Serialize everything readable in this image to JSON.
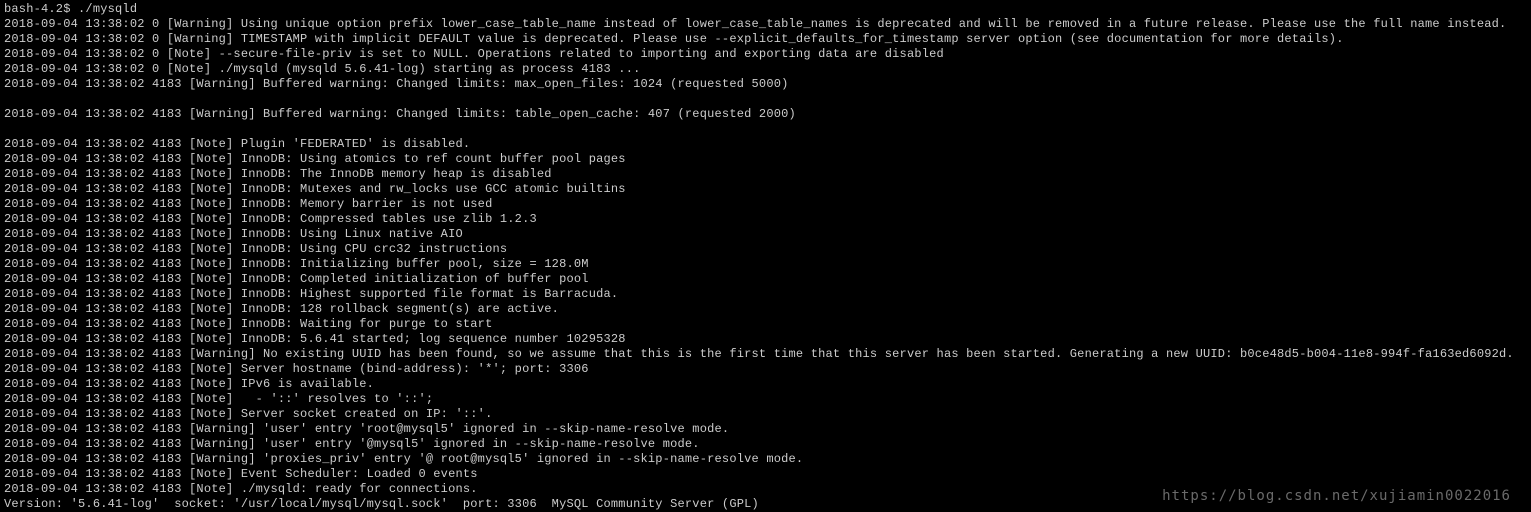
{
  "prompt": "bash-4.2$ ./mysqld",
  "lines": [
    "2018-09-04 13:38:02 0 [Warning] Using unique option prefix lower_case_table_name instead of lower_case_table_names is deprecated and will be removed in a future release. Please use the full name instead.",
    "2018-09-04 13:38:02 0 [Warning] TIMESTAMP with implicit DEFAULT value is deprecated. Please use --explicit_defaults_for_timestamp server option (see documentation for more details).",
    "2018-09-04 13:38:02 0 [Note] --secure-file-priv is set to NULL. Operations related to importing and exporting data are disabled",
    "2018-09-04 13:38:02 0 [Note] ./mysqld (mysqld 5.6.41-log) starting as process 4183 ...",
    "2018-09-04 13:38:02 4183 [Warning] Buffered warning: Changed limits: max_open_files: 1024 (requested 5000)",
    "",
    "2018-09-04 13:38:02 4183 [Warning] Buffered warning: Changed limits: table_open_cache: 407 (requested 2000)",
    "",
    "2018-09-04 13:38:02 4183 [Note] Plugin 'FEDERATED' is disabled.",
    "2018-09-04 13:38:02 4183 [Note] InnoDB: Using atomics to ref count buffer pool pages",
    "2018-09-04 13:38:02 4183 [Note] InnoDB: The InnoDB memory heap is disabled",
    "2018-09-04 13:38:02 4183 [Note] InnoDB: Mutexes and rw_locks use GCC atomic builtins",
    "2018-09-04 13:38:02 4183 [Note] InnoDB: Memory barrier is not used",
    "2018-09-04 13:38:02 4183 [Note] InnoDB: Compressed tables use zlib 1.2.3",
    "2018-09-04 13:38:02 4183 [Note] InnoDB: Using Linux native AIO",
    "2018-09-04 13:38:02 4183 [Note] InnoDB: Using CPU crc32 instructions",
    "2018-09-04 13:38:02 4183 [Note] InnoDB: Initializing buffer pool, size = 128.0M",
    "2018-09-04 13:38:02 4183 [Note] InnoDB: Completed initialization of buffer pool",
    "2018-09-04 13:38:02 4183 [Note] InnoDB: Highest supported file format is Barracuda.",
    "2018-09-04 13:38:02 4183 [Note] InnoDB: 128 rollback segment(s) are active.",
    "2018-09-04 13:38:02 4183 [Note] InnoDB: Waiting for purge to start",
    "2018-09-04 13:38:02 4183 [Note] InnoDB: 5.6.41 started; log sequence number 10295328",
    "2018-09-04 13:38:02 4183 [Warning] No existing UUID has been found, so we assume that this is the first time that this server has been started. Generating a new UUID: b0ce48d5-b004-11e8-994f-fa163ed6092d.",
    "2018-09-04 13:38:02 4183 [Note] Server hostname (bind-address): '*'; port: 3306",
    "2018-09-04 13:38:02 4183 [Note] IPv6 is available.",
    "2018-09-04 13:38:02 4183 [Note]   - '::' resolves to '::';",
    "2018-09-04 13:38:02 4183 [Note] Server socket created on IP: '::'.",
    "2018-09-04 13:38:02 4183 [Warning] 'user' entry 'root@mysql5' ignored in --skip-name-resolve mode.",
    "2018-09-04 13:38:02 4183 [Warning] 'user' entry '@mysql5' ignored in --skip-name-resolve mode.",
    "2018-09-04 13:38:02 4183 [Warning] 'proxies_priv' entry '@ root@mysql5' ignored in --skip-name-resolve mode.",
    "2018-09-04 13:38:02 4183 [Note] Event Scheduler: Loaded 0 events",
    "2018-09-04 13:38:02 4183 [Note] ./mysqld: ready for connections.",
    "Version: '5.6.41-log'  socket: '/usr/local/mysql/mysql.sock'  port: 3306  MySQL Community Server (GPL)"
  ],
  "watermark": "https://blog.csdn.net/xujiamin0022016"
}
